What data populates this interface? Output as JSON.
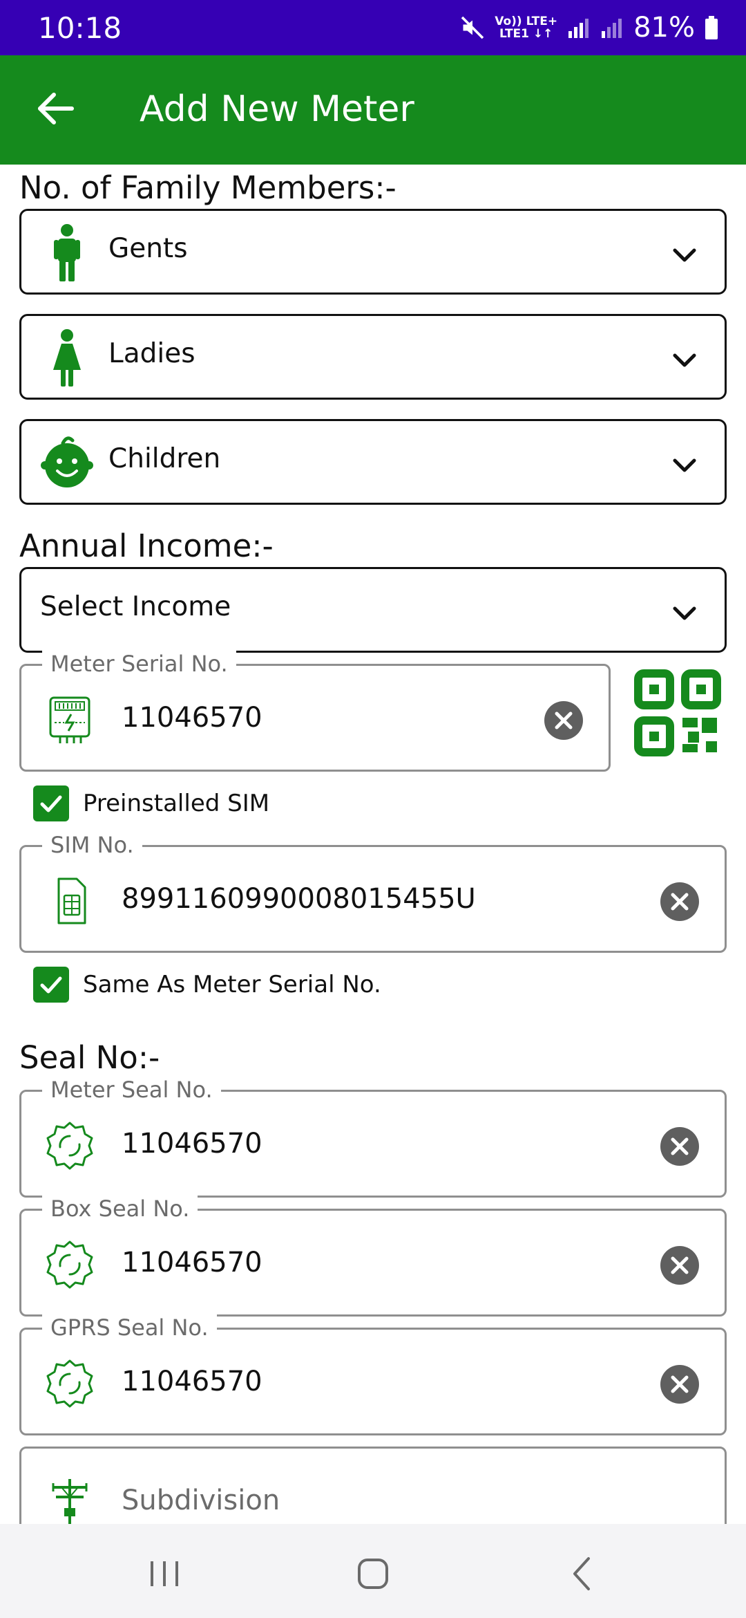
{
  "status_bar": {
    "time": "10:18",
    "network_top": "Vo)) LTE+",
    "network_bottom": "LTE1 ↓↑",
    "battery": "81%"
  },
  "app_bar": {
    "title": "Add New Meter",
    "back_icon": "arrow-left-icon"
  },
  "family": {
    "label": "No. of Family Members:-",
    "gents": "Gents",
    "ladies": "Ladies",
    "children": "Children"
  },
  "income": {
    "label": "Annual Income:-",
    "value": "Select Income"
  },
  "meter_serial": {
    "legend": "Meter Serial No.",
    "value": "11046570"
  },
  "preinstalled_sim": {
    "label": "Preinstalled SIM",
    "checked": true
  },
  "sim": {
    "legend": "SIM No.",
    "value": "8991160990008015455U"
  },
  "same_as_serial": {
    "label": "Same As Meter Serial No.",
    "checked": true
  },
  "seal": {
    "label": "Seal No:-",
    "meter_legend": "Meter Seal No.",
    "meter_value": "11046570",
    "box_legend": "Box Seal No.",
    "box_value": "11046570",
    "gprs_legend": "GPRS Seal No.",
    "gprs_value": "11046570"
  },
  "subdivision": {
    "placeholder": "Subdivision"
  },
  "colors": {
    "status_bar": "#3600b4",
    "app_bar": "#158a1d",
    "accent": "#158a1d",
    "clear_button": "#5f5f5f"
  }
}
